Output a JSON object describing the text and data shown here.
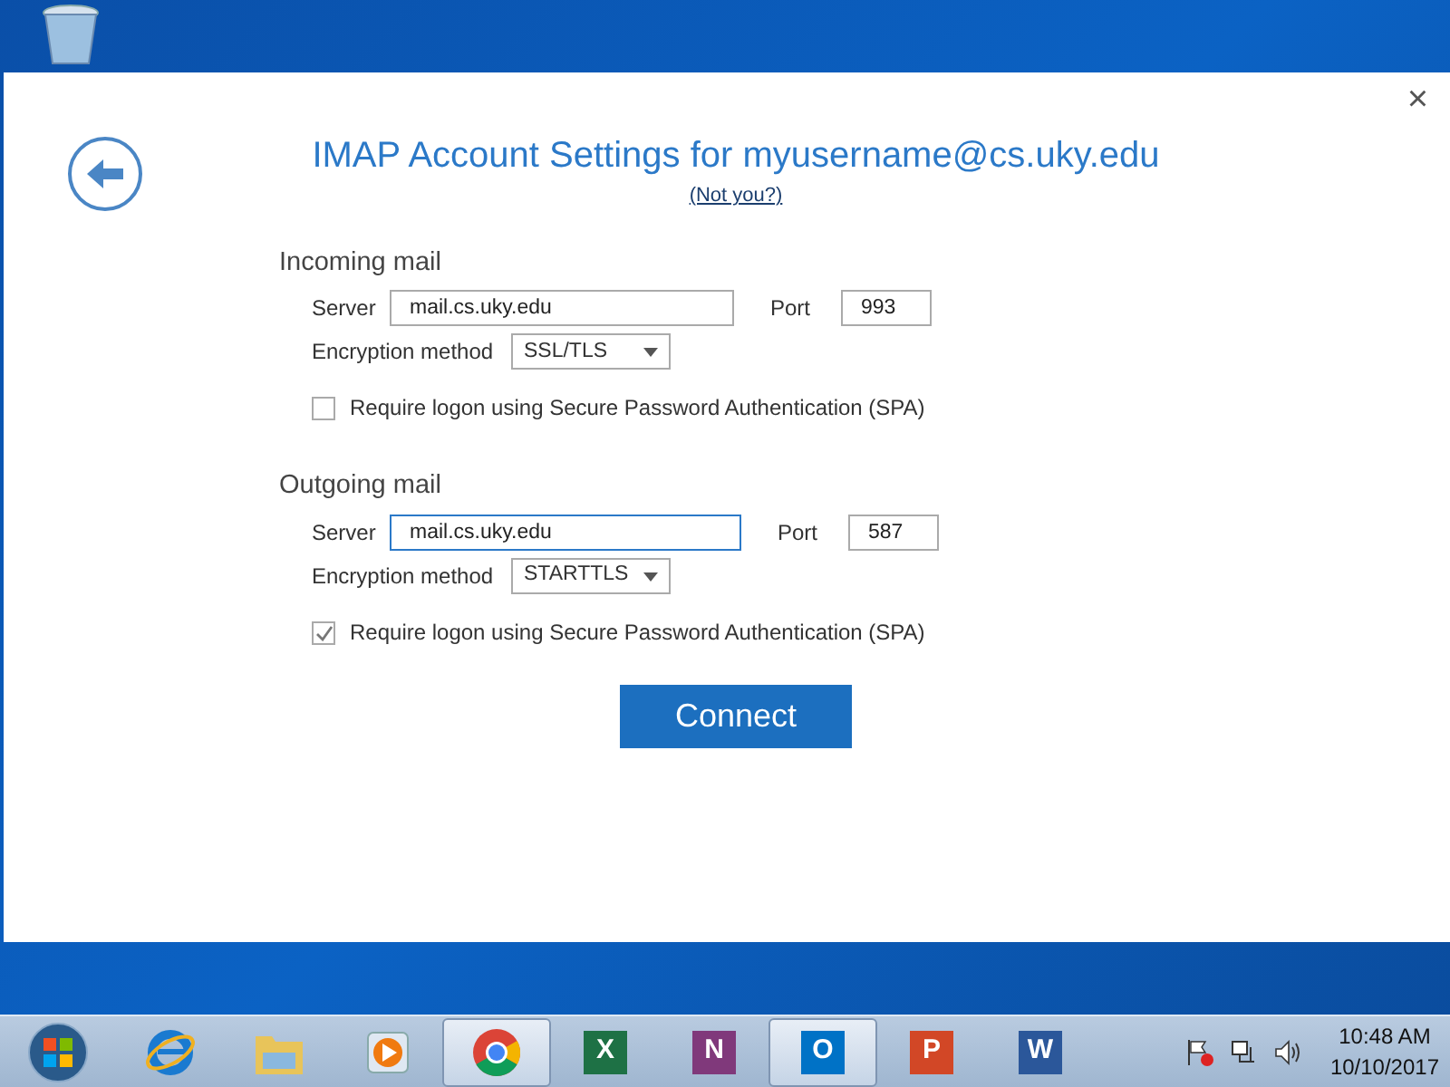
{
  "dialog": {
    "title": "IMAP Account Settings for myusername@cs.uky.edu",
    "not_you_link": "(Not you?)",
    "close": "×"
  },
  "sections": [
    {
      "heading": "Incoming mail",
      "server_label": "Server",
      "server": "mail.cs.uky.edu",
      "server_focused": false,
      "port_label": "Port",
      "port": "993",
      "encryption_label": "Encryption method",
      "encryption": "SSL/TLS",
      "spa_label": "Require logon using Secure Password Authentication (SPA)",
      "spa_checked": false
    },
    {
      "heading": "Outgoing mail",
      "server_label": "Server",
      "server": "mail.cs.uky.edu",
      "server_focused": true,
      "port_label": "Port",
      "port": "587",
      "encryption_label": "Encryption method",
      "encryption": "STARTTLS",
      "spa_label": "Require logon using Secure Password Authentication (SPA)",
      "spa_checked": true
    }
  ],
  "connect_button": "Connect",
  "taskbar": {
    "apps": [
      {
        "kind": "ie",
        "selected": false
      },
      {
        "kind": "folder",
        "selected": false
      },
      {
        "kind": "media",
        "selected": false
      },
      {
        "kind": "chrome",
        "selected": true
      },
      {
        "kind": "office",
        "letter": "X",
        "color": "#1e7145",
        "selected": false
      },
      {
        "kind": "office",
        "letter": "N",
        "color": "#80397b",
        "selected": false
      },
      {
        "kind": "office",
        "letter": "O",
        "color": "#0072c6",
        "selected": true
      },
      {
        "kind": "office",
        "letter": "P",
        "color": "#d24726",
        "selected": false
      },
      {
        "kind": "office",
        "letter": "W",
        "color": "#2b579a",
        "selected": false
      }
    ],
    "time": "10:48 AM",
    "date": "10/10/2017"
  }
}
